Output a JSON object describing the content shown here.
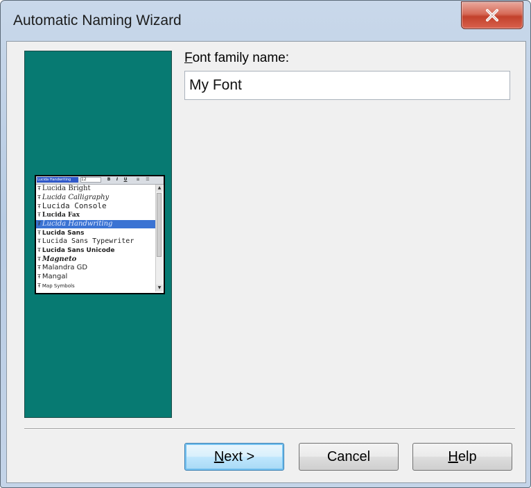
{
  "window": {
    "title": "Automatic Naming Wizard"
  },
  "titlebar_buttons": {
    "close_icon": "close-icon"
  },
  "form": {
    "font_family_label_accel": "F",
    "font_family_label_rest": "ont family name:",
    "font_family_value": "My Font"
  },
  "preview": {
    "toolbar_font": "Lucida Handwriting",
    "toolbar_size": "12",
    "toolbar_buttons": [
      "B",
      "I",
      "U"
    ],
    "fonts": [
      "Lucida Bright",
      "Lucida Calligraphy",
      "Lucida Console",
      "Lucida Fax",
      "Lucida Handwriting",
      "Lucida Sans",
      "Lucida Sans Typewriter",
      "Lucida Sans Unicode",
      "Magneto",
      "Malandra GD",
      "Mangal",
      "Map    Symbols"
    ],
    "selected_index": 4
  },
  "buttons": {
    "next_accel": "N",
    "next_rest": "ext >",
    "cancel": "Cancel",
    "help_accel": "H",
    "help_rest": "elp"
  },
  "colors": {
    "side_panel": "#077a72",
    "selection": "#3a73d3"
  }
}
